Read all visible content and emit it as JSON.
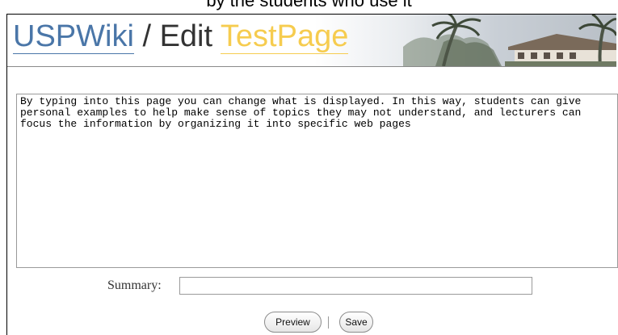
{
  "caption": "by the students who use it",
  "header": {
    "site_name": "USPWiki",
    "separator": " / Edit ",
    "page_name": "TestPage"
  },
  "editor": {
    "content": "By typing into this page you can change what is displayed. In this way, students can give personal examples to help make sense of topics they may not understand, and lecturers can focus the information by organizing it into specific web pages"
  },
  "summary": {
    "label": "Summary:",
    "value": ""
  },
  "actions": {
    "preview_label": "Preview",
    "divider": "|",
    "save_label": "Save"
  },
  "colors": {
    "site_name": "#4a76a8",
    "page_name": "#f6cc4f"
  }
}
